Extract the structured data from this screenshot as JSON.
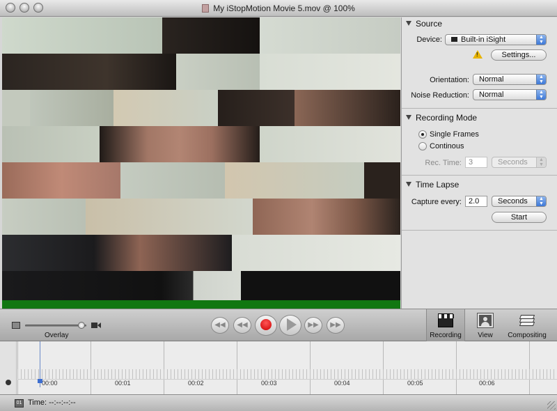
{
  "window": {
    "title": "My iStopMotion Movie 5.mov @ 100%"
  },
  "source": {
    "heading": "Source",
    "device_label": "Device:",
    "device_value": "Built-in iSight",
    "settings_button": "Settings...",
    "orientation_label": "Orientation:",
    "orientation_value": "Normal",
    "noise_label": "Noise Reduction:",
    "noise_value": "Normal"
  },
  "recording_mode": {
    "heading": "Recording Mode",
    "single_frames": "Single Frames",
    "continuous": "Continous",
    "rec_time_label": "Rec. Time:",
    "rec_time_value": "3",
    "rec_time_unit": "Seconds"
  },
  "time_lapse": {
    "heading": "Time Lapse",
    "capture_label": "Capture every:",
    "capture_value": "2.0",
    "capture_unit": "Seconds",
    "start_button": "Start"
  },
  "toolbar": {
    "overlay_label": "Overlay",
    "overlay_level": 0.97,
    "recording_label": "Recording",
    "view_label": "View",
    "compositing_label": "Compositing"
  },
  "timeline": {
    "labels": [
      "00:00",
      "00:01",
      "00:02",
      "00:03",
      "00:04",
      "00:05",
      "00:06"
    ]
  },
  "status": {
    "badge": "01",
    "time_text": "Time: --:--:--:--"
  },
  "colors": {
    "record": "#cc0000",
    "progress_green": "#117711",
    "accent_blue": "#3c78d8"
  }
}
